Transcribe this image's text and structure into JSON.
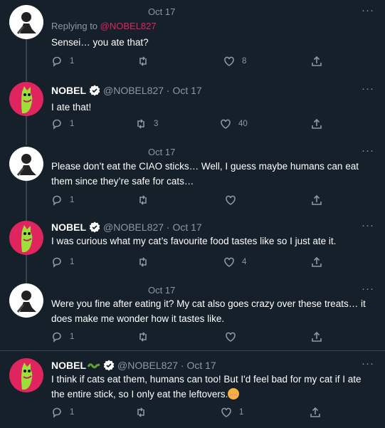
{
  "tweets": [
    {
      "date": "Oct 17",
      "replying_prefix": "Replying to ",
      "replying_handle": "@NOBEL827",
      "text": "Sensei… you ate that?",
      "reply_count": "1",
      "retweet_count": "",
      "like_count": "8"
    },
    {
      "name": "NOBEL",
      "handle_date": "@NOBEL827 · Oct 17",
      "text": "I ate that!",
      "reply_count": "1",
      "retweet_count": "3",
      "like_count": "40"
    },
    {
      "date": "Oct 17",
      "text": "Please don’t eat the CIAO sticks… Well, I guess maybe humans can eat them since they’re safe for cats…",
      "reply_count": "1",
      "retweet_count": "",
      "like_count": ""
    },
    {
      "name": "NOBEL",
      "handle_date": "@NOBEL827 · Oct 17",
      "text": "I was curious what my cat’s favourite food tastes like so I just ate it.",
      "reply_count": "1",
      "retweet_count": "",
      "like_count": "4"
    },
    {
      "date": "Oct 17",
      "text": "Were you fine after eating it? My cat also goes crazy over these treats… it does make me wonder how it tastes like.",
      "reply_count": "1",
      "retweet_count": "",
      "like_count": ""
    },
    {
      "name": "NOBEL",
      "handle_date": "@NOBEL827 · Oct 17",
      "text": "I think if cats eat them, humans can too! But I'd feel bad for my cat if I ate the entire stick, so I only eat the leftovers.",
      "reply_count": "1",
      "retweet_count": "",
      "like_count": "1"
    }
  ],
  "more_label": "···",
  "colors": {
    "background": "#15202b",
    "accent": "#e0245e",
    "verified": "#ffffff",
    "muted": "#8b98a5"
  },
  "icons": [
    "reply-icon",
    "retweet-icon",
    "like-icon",
    "share-icon",
    "verified-badge-icon",
    "more-icon",
    "blushing-emoji-icon",
    "snake-emoji-icon"
  ]
}
